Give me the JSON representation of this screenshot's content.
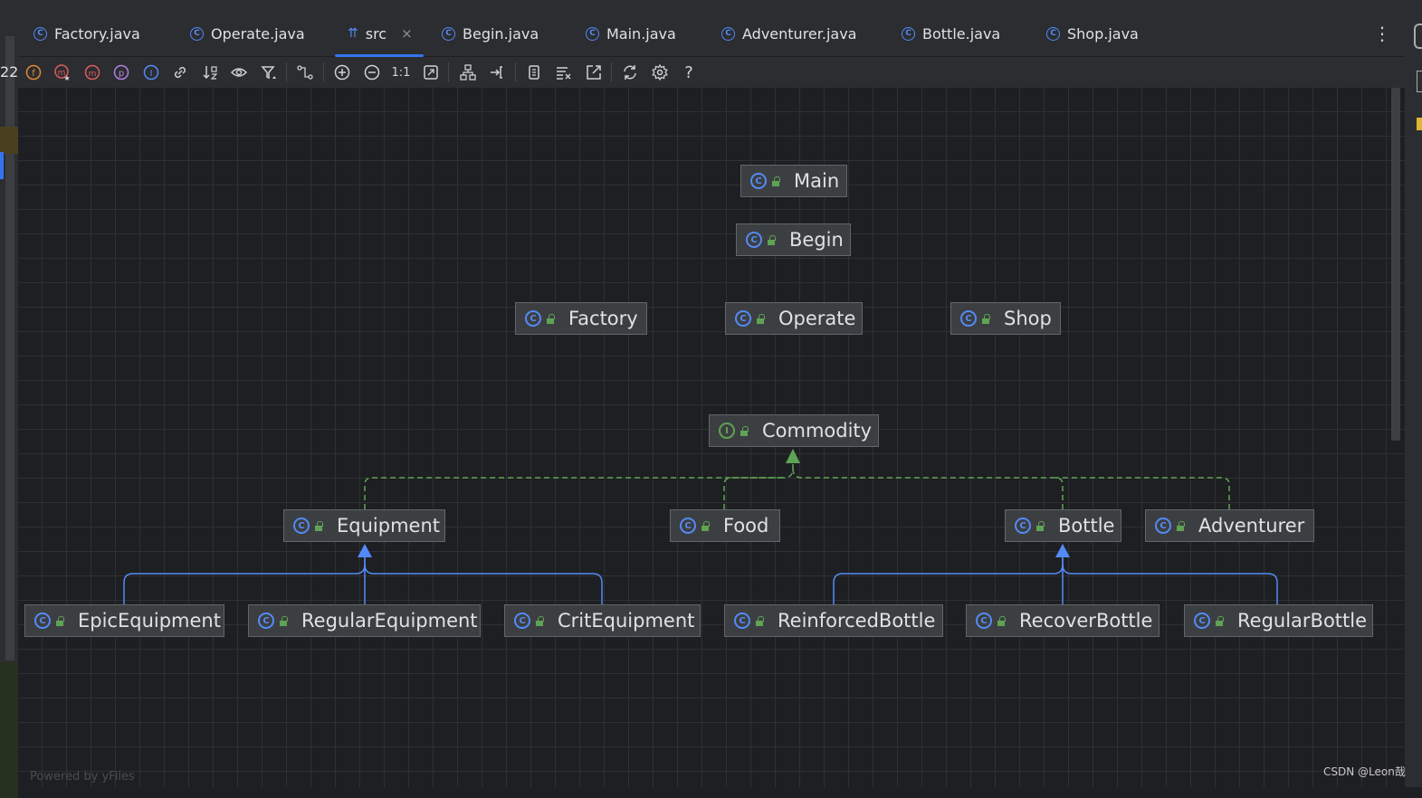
{
  "left_number": "22",
  "tabs": [
    {
      "label": "Factory.java",
      "icon": "class-icon",
      "active": false
    },
    {
      "label": "Operate.java",
      "icon": "class-icon",
      "active": false
    },
    {
      "label": "src",
      "icon": "diagram-icon",
      "active": true,
      "close": "×"
    },
    {
      "label": "Begin.java",
      "icon": "class-icon",
      "active": false
    },
    {
      "label": "Main.java",
      "icon": "class-icon",
      "active": false
    },
    {
      "label": "Adventurer.java",
      "icon": "class-icon",
      "active": false
    },
    {
      "label": "Bottle.java",
      "icon": "class-icon",
      "active": false
    },
    {
      "label": "Shop.java",
      "icon": "class-icon",
      "active": false
    }
  ],
  "more_menu": "⋮",
  "toolbar": {
    "items": [
      "show-fields-icon",
      "show-constructors-icon",
      "show-methods-icon",
      "show-properties-icon",
      "show-inner-classes-icon",
      "show-dependencies-icon",
      "sort-icon",
      "visibility-icon",
      "filter-icon",
      "edge-routing-icon",
      "zoom-in-icon",
      "zoom-out-icon",
      "actual-size-icon",
      "fit-content-icon",
      "layout-icon",
      "apply-layout-icon",
      "copy-icon",
      "export-text-icon",
      "open-external-icon",
      "refresh-icon",
      "settings-icon",
      "help-icon"
    ],
    "actual_size_label": "1:1",
    "help_label": "?"
  },
  "diagram": {
    "nodes": [
      {
        "id": "main",
        "label": "Main",
        "kind": "class"
      },
      {
        "id": "begin",
        "label": "Begin",
        "kind": "class"
      },
      {
        "id": "factory",
        "label": "Factory",
        "kind": "class"
      },
      {
        "id": "operate",
        "label": "Operate",
        "kind": "class"
      },
      {
        "id": "shop",
        "label": "Shop",
        "kind": "class"
      },
      {
        "id": "commodity",
        "label": "Commodity",
        "kind": "interface"
      },
      {
        "id": "equipment",
        "label": "Equipment",
        "kind": "class"
      },
      {
        "id": "food",
        "label": "Food",
        "kind": "class"
      },
      {
        "id": "bottle",
        "label": "Bottle",
        "kind": "class"
      },
      {
        "id": "adventurer",
        "label": "Adventurer",
        "kind": "class"
      },
      {
        "id": "epic",
        "label": "EpicEquipment",
        "kind": "class"
      },
      {
        "id": "regular_eq",
        "label": "RegularEquipment",
        "kind": "class"
      },
      {
        "id": "crit",
        "label": "CritEquipment",
        "kind": "class"
      },
      {
        "id": "reinforced",
        "label": "ReinforcedBottle",
        "kind": "class"
      },
      {
        "id": "recover",
        "label": "RecoverBottle",
        "kind": "class"
      },
      {
        "id": "regular_bottle",
        "label": "RegularBottle",
        "kind": "class"
      }
    ],
    "edges": [
      {
        "from": "equipment",
        "to": "commodity",
        "type": "implements"
      },
      {
        "from": "food",
        "to": "commodity",
        "type": "implements"
      },
      {
        "from": "bottle",
        "to": "commodity",
        "type": "implements"
      },
      {
        "from": "adventurer",
        "to": "commodity",
        "type": "implements"
      },
      {
        "from": "epic",
        "to": "equipment",
        "type": "extends"
      },
      {
        "from": "regular_eq",
        "to": "equipment",
        "type": "extends"
      },
      {
        "from": "crit",
        "to": "equipment",
        "type": "extends"
      },
      {
        "from": "reinforced",
        "to": "bottle",
        "type": "extends"
      },
      {
        "from": "recover",
        "to": "bottle",
        "type": "extends"
      },
      {
        "from": "regular_bottle",
        "to": "bottle",
        "type": "extends"
      }
    ],
    "colors": {
      "implements": "#5fa354",
      "extends": "#548af7"
    }
  },
  "footer": {
    "powered_by": "Powered by yFiles",
    "watermark": "CSDN @Leon哉"
  }
}
